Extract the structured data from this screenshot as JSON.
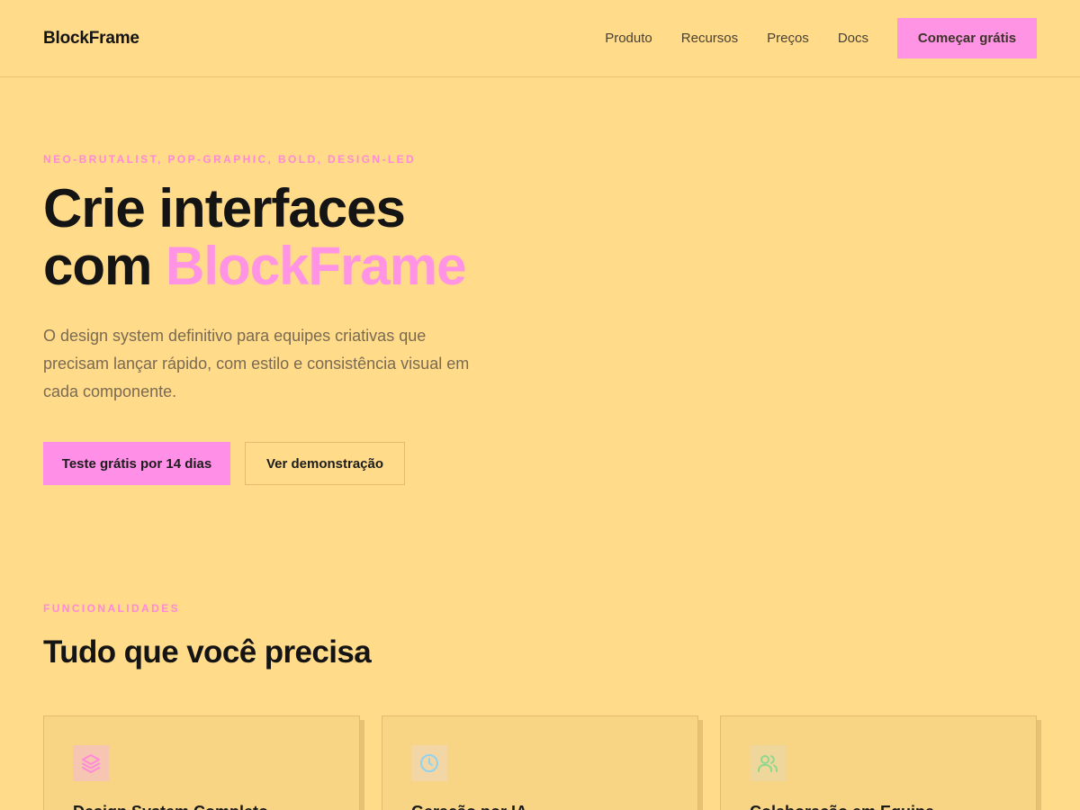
{
  "nav": {
    "brand": "BlockFrame",
    "links": [
      "Produto",
      "Recursos",
      "Preços",
      "Docs"
    ],
    "cta": "Começar grátis"
  },
  "hero": {
    "eyebrow": "NEO-BRUTALIST, POP-GRAPHIC, BOLD, DESIGN-LED",
    "title_line1": "Crie interfaces",
    "title_line2_prefix": "com ",
    "title_accent": "BlockFrame",
    "description": "O design system definitivo para equipes criativas que precisam lançar rápido, com estilo e consistência visual em cada componente.",
    "primary_button": "Teste grátis por 14 dias",
    "secondary_button": "Ver demonstração"
  },
  "features": {
    "eyebrow": "FUNCIONALIDADES",
    "title": "Tudo que você precisa",
    "cards": [
      {
        "title": "Design System Completo",
        "icon": "layers-icon"
      },
      {
        "title": "Geração por IA",
        "icon": "clock-icon"
      },
      {
        "title": "Colaboração em Equipe",
        "icon": "users-icon"
      }
    ]
  },
  "colors": {
    "background": "#ffdb8a",
    "accent": "#ff94e4",
    "text": "#141414"
  }
}
